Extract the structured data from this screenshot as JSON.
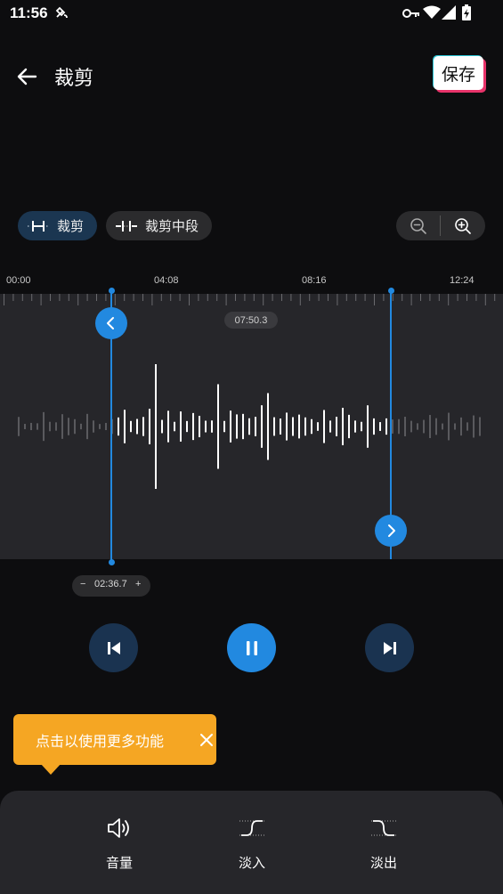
{
  "status_bar": {
    "time": "11:56"
  },
  "header": {
    "title": "裁剪",
    "save_label": "保存"
  },
  "modes": {
    "trim_label": "裁剪",
    "trim_middle_label": "裁剪中段"
  },
  "timeline": {
    "labels": [
      "00:00",
      "04:08",
      "08:16",
      "12:24"
    ]
  },
  "selection": {
    "duration": "07:50.3",
    "start_time": "02:36.7",
    "minus": "−",
    "plus": "+"
  },
  "tooltip": {
    "text": "点击以使用更多功能"
  },
  "tools": [
    {
      "label": "音量",
      "icon": "volume-icon"
    },
    {
      "label": "淡入",
      "icon": "fade-in-icon"
    },
    {
      "label": "淡出",
      "icon": "fade-out-icon"
    }
  ],
  "colors": {
    "accent": "#2289e0",
    "tooltip": "#f5a623",
    "background": "#0d0d0f",
    "panel": "#26262a"
  }
}
